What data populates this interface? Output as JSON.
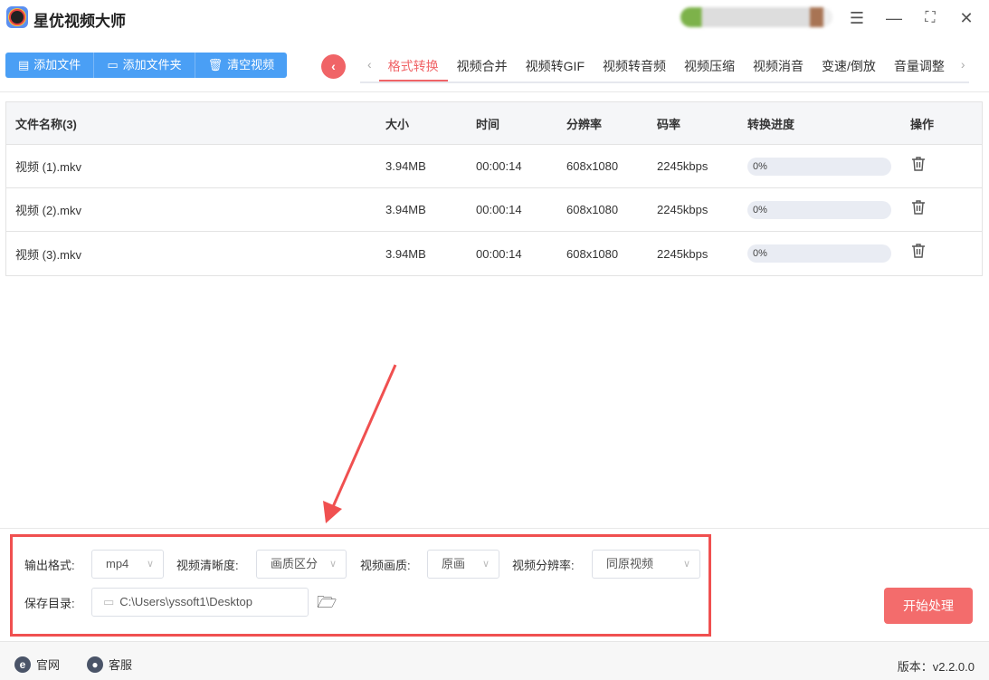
{
  "app": {
    "title": "星优视频大师"
  },
  "toolbar": {
    "add_file": "添加文件",
    "add_folder": "添加文件夹",
    "clear": "清空视频"
  },
  "tabs": [
    "格式转换",
    "视频合并",
    "视频转GIF",
    "视频转音频",
    "视频压缩",
    "视频消音",
    "变速/倒放",
    "音量调整"
  ],
  "table": {
    "headers": {
      "name": "文件名称(3)",
      "size": "大小",
      "time": "时间",
      "resolution": "分辨率",
      "bitrate": "码率",
      "progress": "转换进度",
      "action": "操作"
    },
    "rows": [
      {
        "name": "视频 (1).mkv",
        "size": "3.94MB",
        "time": "00:00:14",
        "resolution": "608x1080",
        "bitrate": "2245kbps",
        "progress": "0%"
      },
      {
        "name": "视频 (2).mkv",
        "size": "3.94MB",
        "time": "00:00:14",
        "resolution": "608x1080",
        "bitrate": "2245kbps",
        "progress": "0%"
      },
      {
        "name": "视频 (3).mkv",
        "size": "3.94MB",
        "time": "00:00:14",
        "resolution": "608x1080",
        "bitrate": "2245kbps",
        "progress": "0%"
      }
    ]
  },
  "settings": {
    "format_label": "输出格式:",
    "format": "mp4",
    "clarity_label": "视频清晰度:",
    "clarity": "画质区分",
    "quality_label": "视频画质:",
    "quality": "原画",
    "resolution_label": "视频分辨率:",
    "resolution": "同原视频",
    "dir_label": "保存目录:",
    "dir": "C:\\Users\\yssoft1\\Desktop"
  },
  "start_button": "开始处理",
  "footer": {
    "website": "官网",
    "service": "客服",
    "version": "版本：v2.2.0.0"
  },
  "colors": {
    "accent": "#f06467",
    "primary": "#4a9ff5",
    "highlight": "#f05050"
  }
}
